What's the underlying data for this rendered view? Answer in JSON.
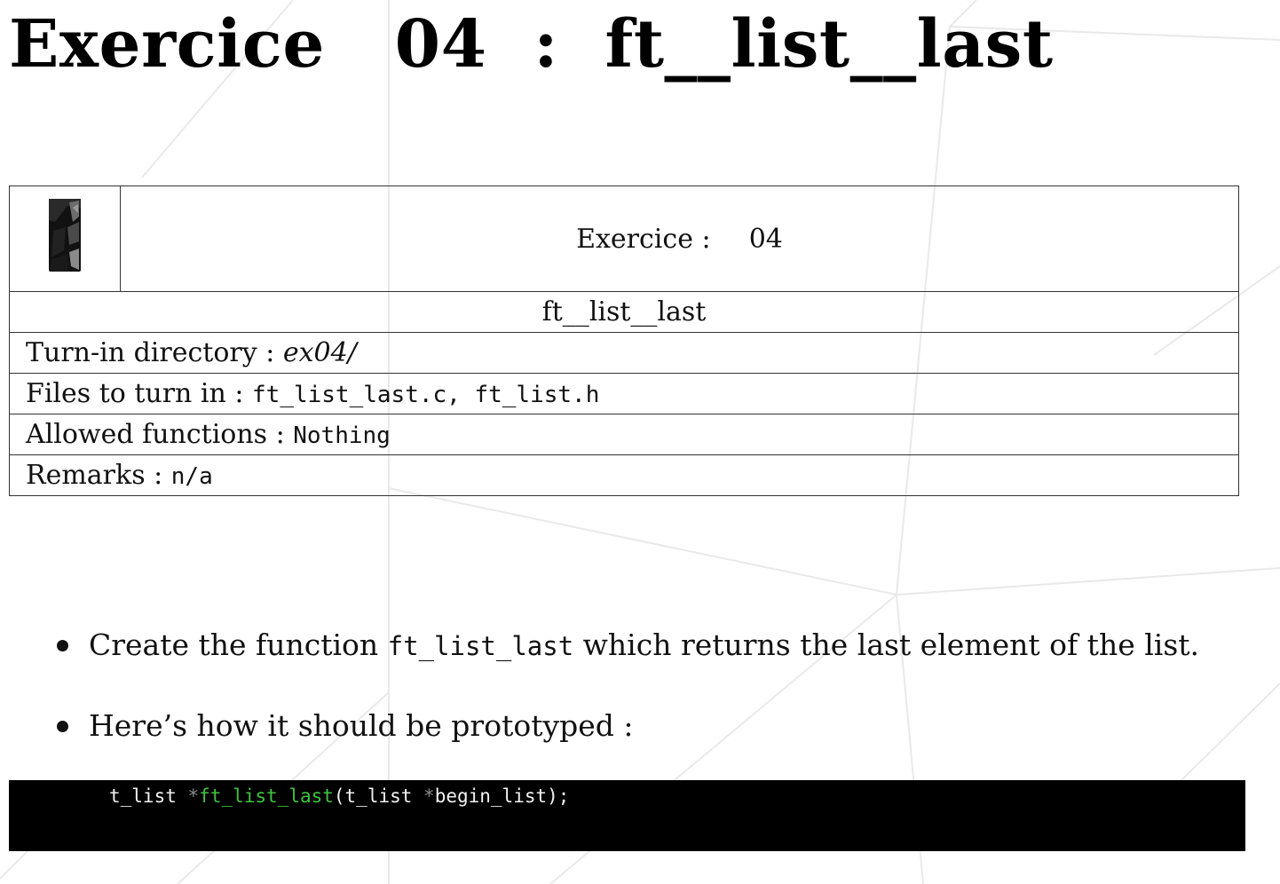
{
  "title": "Exercice   04  :  ft__list__last",
  "header_table": {
    "exercise_label": "Exercice :",
    "exercise_number": "04",
    "exercise_name": "ft__list__last",
    "turn_in_label": "Turn-in directory : ",
    "turn_in_value": "ex04/",
    "files_label": "Files to turn in : ",
    "files_value": "ft_list_last.c, ft_list.h",
    "allowed_label": "Allowed functions : ",
    "allowed_value": "Nothing",
    "remarks_label": "Remarks : ",
    "remarks_value": "n/a"
  },
  "bullets": {
    "item1_pre": "Create the function ",
    "item1_code": "ft_list_last",
    "item1_post": " which returns the last element of the list.",
    "item2": "Here’s how it should be prototyped :"
  },
  "code": {
    "type": "t_list ",
    "star": "*",
    "fn": "ft_list_last",
    "args_open": "(t_list ",
    "arg_star": "*",
    "args_rest": "begin_list);"
  },
  "colors": {
    "code_background": "#000000",
    "code_function": "#3ec43e",
    "code_text": "#f2f2f2"
  },
  "icons": {
    "logo": "42-school-logo"
  }
}
